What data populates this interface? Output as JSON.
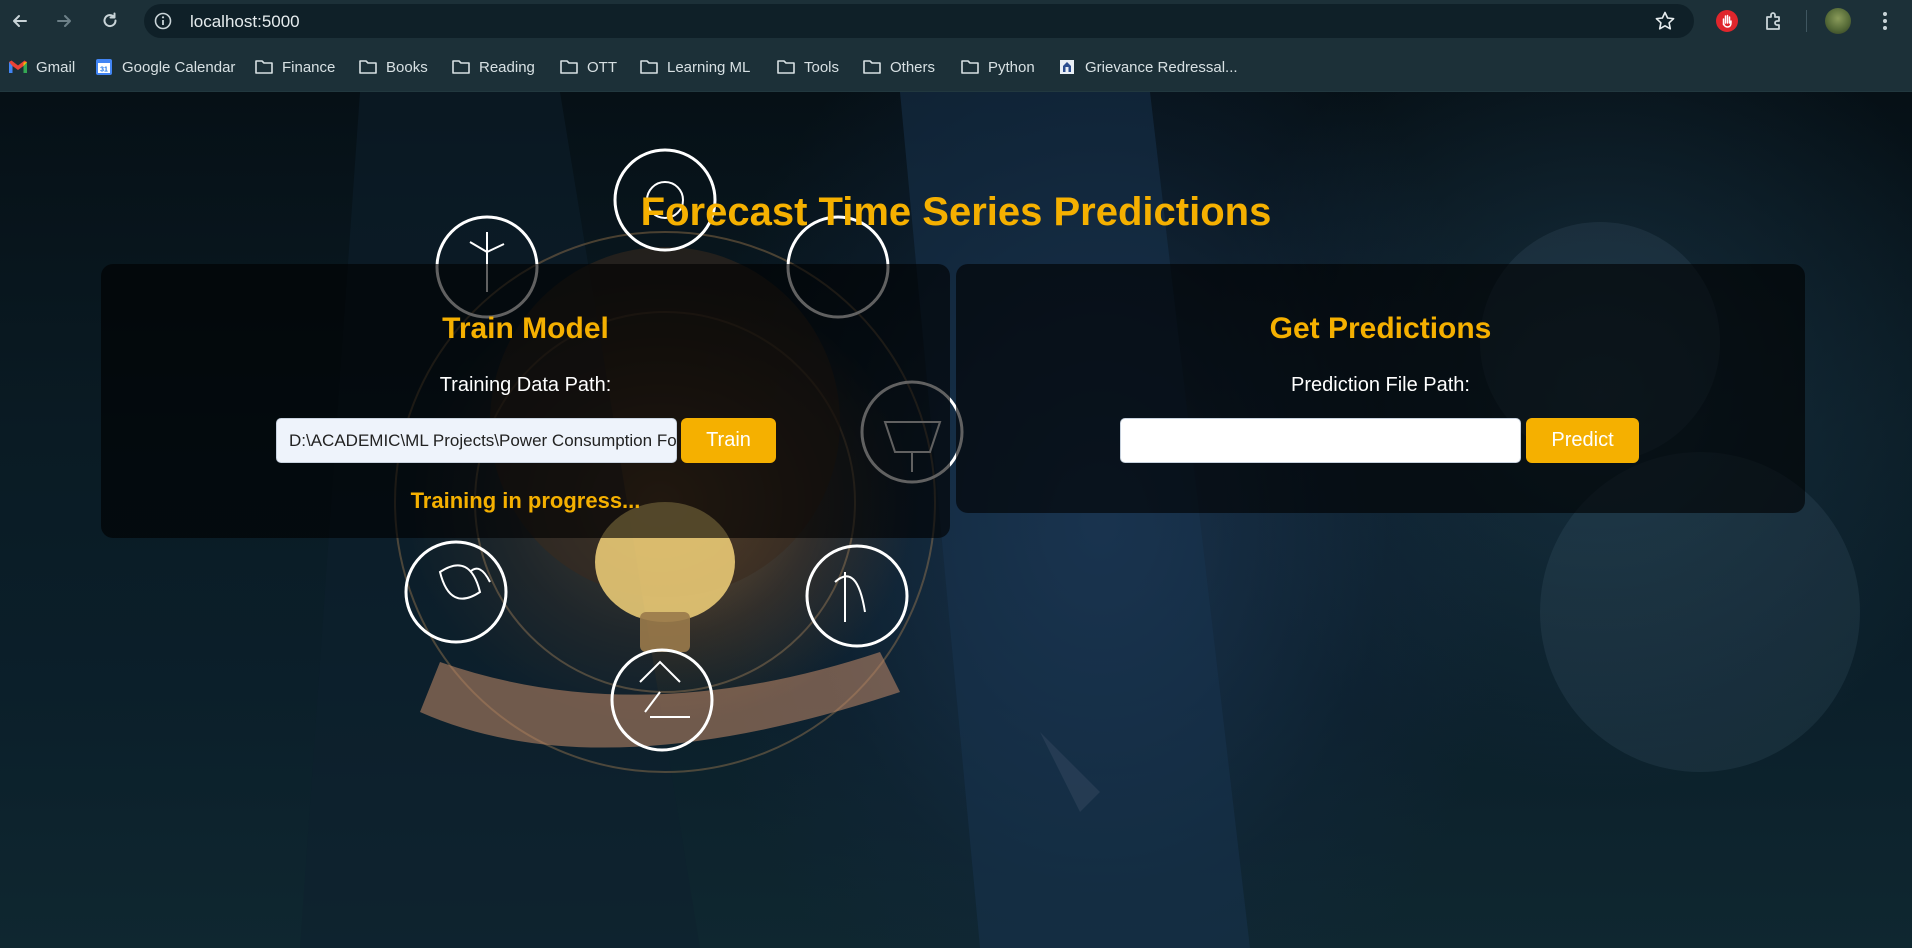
{
  "browser": {
    "url": "localhost:5000",
    "bookmarks": [
      {
        "label": "Gmail",
        "icon": "gmail-icon"
      },
      {
        "label": "Google Calendar",
        "icon": "calendar-icon"
      },
      {
        "label": "Finance",
        "icon": "folder-icon"
      },
      {
        "label": "Books",
        "icon": "folder-icon"
      },
      {
        "label": "Reading",
        "icon": "folder-icon"
      },
      {
        "label": "OTT",
        "icon": "folder-icon"
      },
      {
        "label": "Learning ML",
        "icon": "folder-icon"
      },
      {
        "label": "Tools",
        "icon": "folder-icon"
      },
      {
        "label": "Others",
        "icon": "folder-icon"
      },
      {
        "label": "Python",
        "icon": "folder-icon"
      },
      {
        "label": "Grievance Redressal...",
        "icon": "emblem-icon"
      }
    ]
  },
  "page": {
    "title": "Forecast Time Series Predictions",
    "train": {
      "title": "Train Model",
      "label": "Training Data Path:",
      "path_value": "D:\\ACADEMIC\\ML Projects\\Power Consumption Forecasting",
      "button": "Train",
      "status": "Training in progress..."
    },
    "predict": {
      "title": "Get Predictions",
      "label": "Prediction File Path:",
      "path_value": "",
      "button": "Predict"
    }
  },
  "colors": {
    "accent": "#f5b000",
    "card_bg": "rgba(0,0,0,0.62)",
    "chrome_bg": "#1c3038"
  }
}
